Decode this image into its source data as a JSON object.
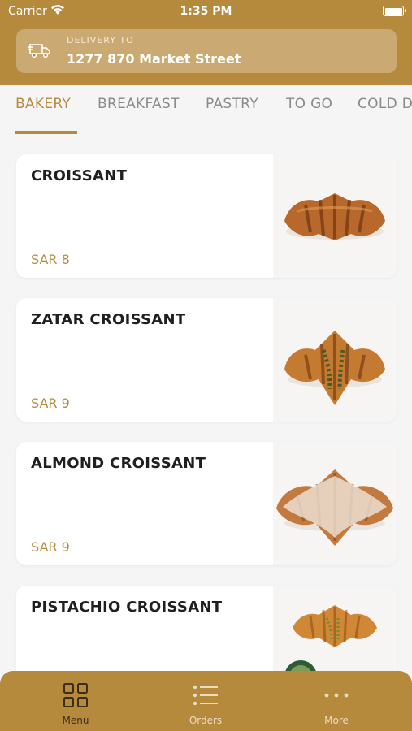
{
  "status": {
    "carrier": "Carrier",
    "time": "1:35 PM"
  },
  "delivery": {
    "label": "DELIVERY TO",
    "address": "1277 870 Market Street"
  },
  "tabs": [
    {
      "label": "BAKERY",
      "active": true
    },
    {
      "label": "BREAKFAST",
      "active": false
    },
    {
      "label": "PASTRY",
      "active": false
    },
    {
      "label": "TO GO",
      "active": false
    },
    {
      "label": "COLD D",
      "active": false
    }
  ],
  "products": [
    {
      "name": "CROISSANT",
      "price": "SAR 8",
      "image": "croissant-image"
    },
    {
      "name": "ZATAR CROISSANT",
      "price": "SAR 9",
      "image": "zatar-croissant-image"
    },
    {
      "name": "ALMOND CROISSANT",
      "price": "SAR 9",
      "image": "almond-croissant-image"
    },
    {
      "name": "PISTACHIO CROISSANT",
      "price": "",
      "image": "pistachio-croissant-image"
    }
  ],
  "bottom_nav": [
    {
      "label": "Menu",
      "icon": "grid-icon",
      "active": true
    },
    {
      "label": "Orders",
      "icon": "list-icon",
      "active": false
    },
    {
      "label": "More",
      "icon": "more-icon",
      "active": false
    }
  ],
  "colors": {
    "brand": "#b68a3c",
    "background": "#f5f5f5",
    "text": "#1f1f1f"
  }
}
